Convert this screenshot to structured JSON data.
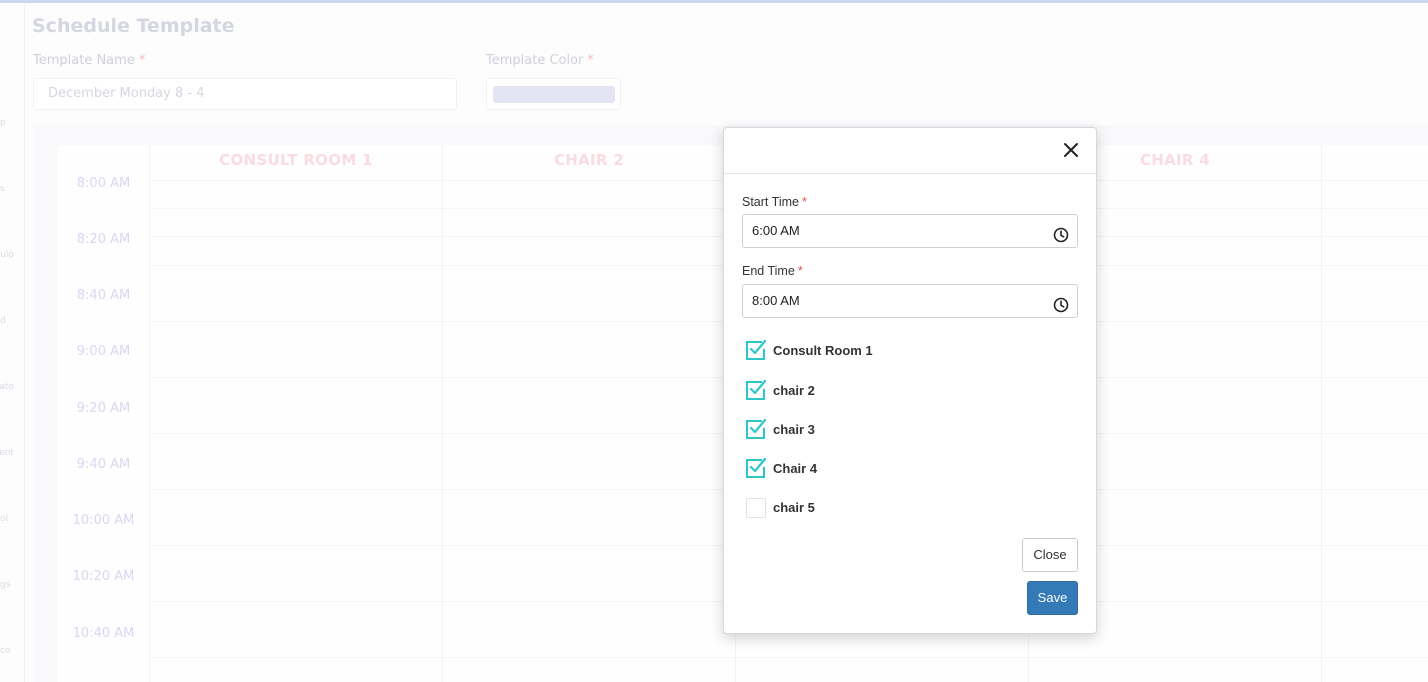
{
  "page": {
    "title": "Schedule Template",
    "template_name_label": "Template Name",
    "template_name_value": "December Monday 8 - 4",
    "template_color_label": "Template Color",
    "required_mark": "*",
    "template_color_value": "#e5e4f4"
  },
  "sidebar": {
    "items": [
      "p",
      "s",
      "ulo",
      "d",
      "ato",
      "ent",
      "ol",
      "gs",
      "co"
    ]
  },
  "schedule": {
    "columns": [
      "CONSULT ROOM 1",
      "CHAIR 2",
      "",
      "CHAIR 4",
      ""
    ],
    "time_slots": [
      "8:00 AM",
      "8:20 AM",
      "8:40 AM",
      "9:00 AM",
      "9:20 AM",
      "9:40 AM",
      "10:00 AM",
      "10:20 AM",
      "10:40 AM"
    ]
  },
  "modal": {
    "start_time_label": "Start Time",
    "start_time_value": "6:00 AM",
    "end_time_label": "End Time",
    "end_time_value": "8:00 AM",
    "required_mark": "*",
    "rooms": [
      {
        "label": "Consult Room 1",
        "checked": true
      },
      {
        "label": "chair 2",
        "checked": true
      },
      {
        "label": "chair 3",
        "checked": true
      },
      {
        "label": "Chair 4",
        "checked": true
      },
      {
        "label": "chair 5",
        "checked": false
      }
    ],
    "close_label": "Close",
    "save_label": "Save"
  },
  "colors": {
    "accent_check": "#2ec7c9",
    "save_button": "#337ab7",
    "required": "#d9534f"
  }
}
